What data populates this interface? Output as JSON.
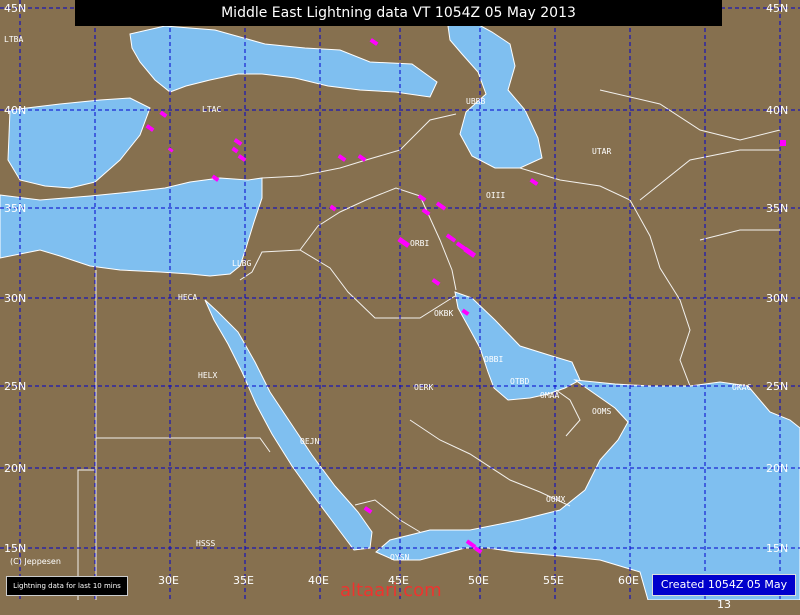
{
  "title": "Middle East Lightning data   VT 1054Z 05 May 2013",
  "created": "Created 1054Z 05 May 13",
  "legend": "Lightning data for last 10 mins",
  "copyright": "(C) Jeppesen",
  "watermark": "altaari.com",
  "colors": {
    "land": "#86704f",
    "water": "#7fbff0",
    "grid": "#0000cc",
    "lightning": "#ff00ff",
    "label": "#ffffff"
  },
  "grid": {
    "lat_labels": [
      "45N",
      "40N",
      "35N",
      "30N",
      "25N",
      "20N",
      "15N"
    ],
    "lon_labels": [
      "30E",
      "35E",
      "40E",
      "45E",
      "50E",
      "55E",
      "60E"
    ]
  },
  "stations": [
    "LTBA",
    "LTAC",
    "UBBB",
    "UTAR",
    "OIII",
    "ORBI",
    "LLBG",
    "HECA",
    "OKBK",
    "OERK",
    "HELX",
    "OBBI",
    "OTBD",
    "OMAA",
    "OEJN",
    "OOMS",
    "OOMX",
    "HSSS",
    "OYSN",
    "OKAC"
  ]
}
